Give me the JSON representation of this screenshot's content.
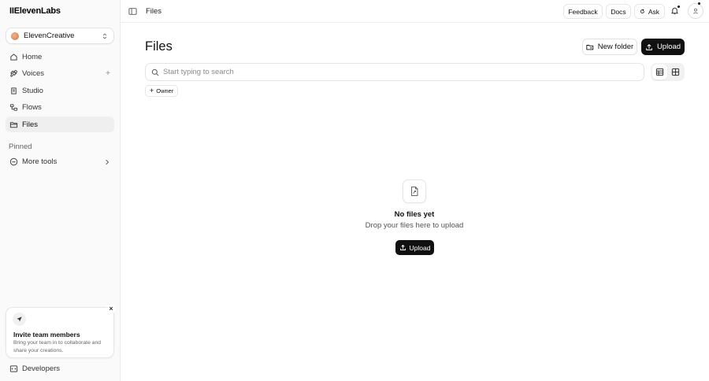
{
  "app": {
    "logo": "IIElevenLabs"
  },
  "sidebar": {
    "workspace": {
      "name": "ElevenCreative",
      "icon": "chevron-updown-icon"
    },
    "items": [
      {
        "label": "Home",
        "icon": "home-icon"
      },
      {
        "label": "Voices",
        "icon": "voices-icon",
        "action": "+"
      },
      {
        "label": "Studio",
        "icon": "studio-icon"
      },
      {
        "label": "Flows",
        "icon": "flows-icon"
      },
      {
        "label": "Files",
        "icon": "files-icon",
        "active": true
      }
    ],
    "pinned_label": "Pinned",
    "more_tools": "More tools",
    "invite": {
      "title": "Invite team members",
      "description": "Bring your team in to collaborate and share your creations.",
      "close": "×"
    },
    "developers": "Developers"
  },
  "topbar": {
    "breadcrumb": "Files",
    "feedback": "Feedback",
    "docs": "Docs",
    "ask": "Ask"
  },
  "main": {
    "title": "Files",
    "new_folder": "New folder",
    "upload": "Upload",
    "search_placeholder": "Start typing to search",
    "filter_owner": "Owner",
    "filter_plus": "+",
    "empty": {
      "title": "No files yet",
      "subtitle": "Drop your files here to upload",
      "upload": "Upload"
    }
  },
  "colors": {
    "accent": "#111111",
    "sidebar_bg": "#fafafa",
    "active_bg": "#efefef"
  }
}
